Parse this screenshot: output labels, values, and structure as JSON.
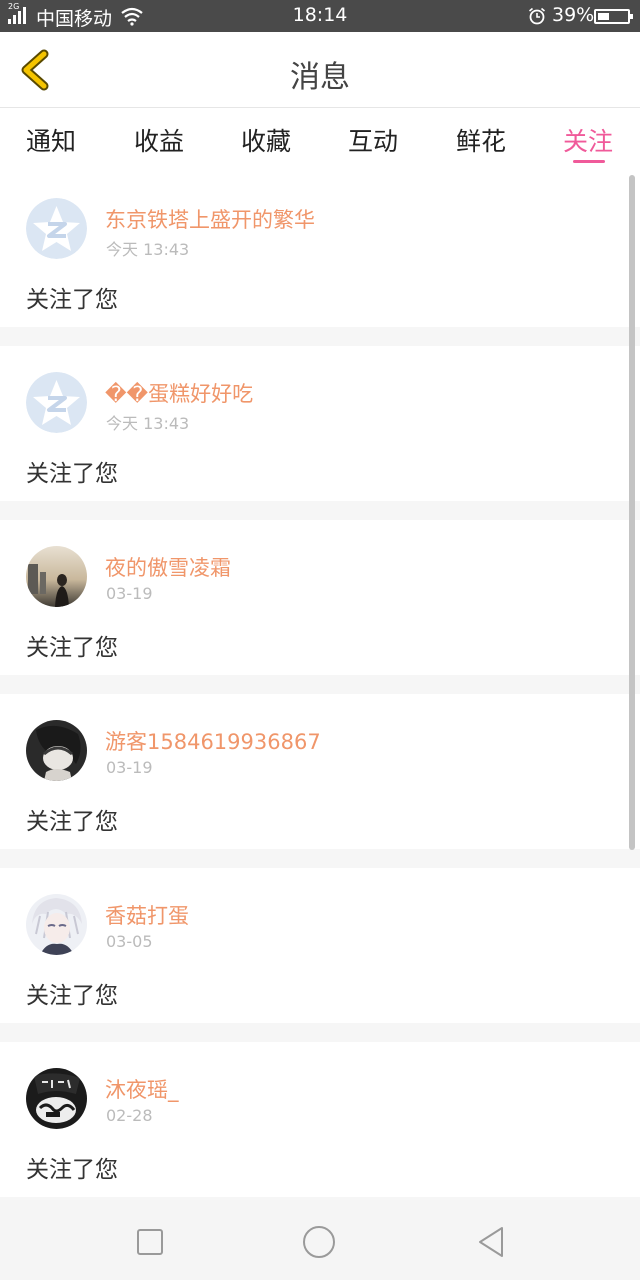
{
  "status_bar": {
    "network_tag": "2G",
    "carrier": "中国移动",
    "time": "18:14",
    "battery": "39%",
    "battery_level": 0.39
  },
  "header": {
    "title": "消息"
  },
  "tabs": [
    {
      "label": "通知",
      "active": false
    },
    {
      "label": "收益",
      "active": false
    },
    {
      "label": "收藏",
      "active": false
    },
    {
      "label": "互动",
      "active": false
    },
    {
      "label": "鲜花",
      "active": false
    },
    {
      "label": "关注",
      "active": true
    }
  ],
  "notifications": [
    {
      "username": "东京铁塔上盛开的繁华",
      "time": "今天 13:43",
      "message": "关注了您",
      "avatar": "default-avatar"
    },
    {
      "username": "��蛋糕好好吃",
      "time": "今天 13:43",
      "message": "关注了您",
      "avatar": "default-avatar"
    },
    {
      "username": "夜的傲雪凌霜",
      "time": "03-19",
      "message": "关注了您",
      "avatar": "photo-avatar"
    },
    {
      "username": "游客1584619936867",
      "time": "03-19",
      "message": "关注了您",
      "avatar": "photo-avatar"
    },
    {
      "username": "香菇打蛋",
      "time": "03-05",
      "message": "关注了您",
      "avatar": "anime-avatar"
    },
    {
      "username": "沐夜瑶_",
      "time": "02-28",
      "message": "关注了您",
      "avatar": "photo-avatar"
    }
  ],
  "colors": {
    "accent": "#f05a9a",
    "username": "#f0966a",
    "back_icon": "#f5c400"
  }
}
